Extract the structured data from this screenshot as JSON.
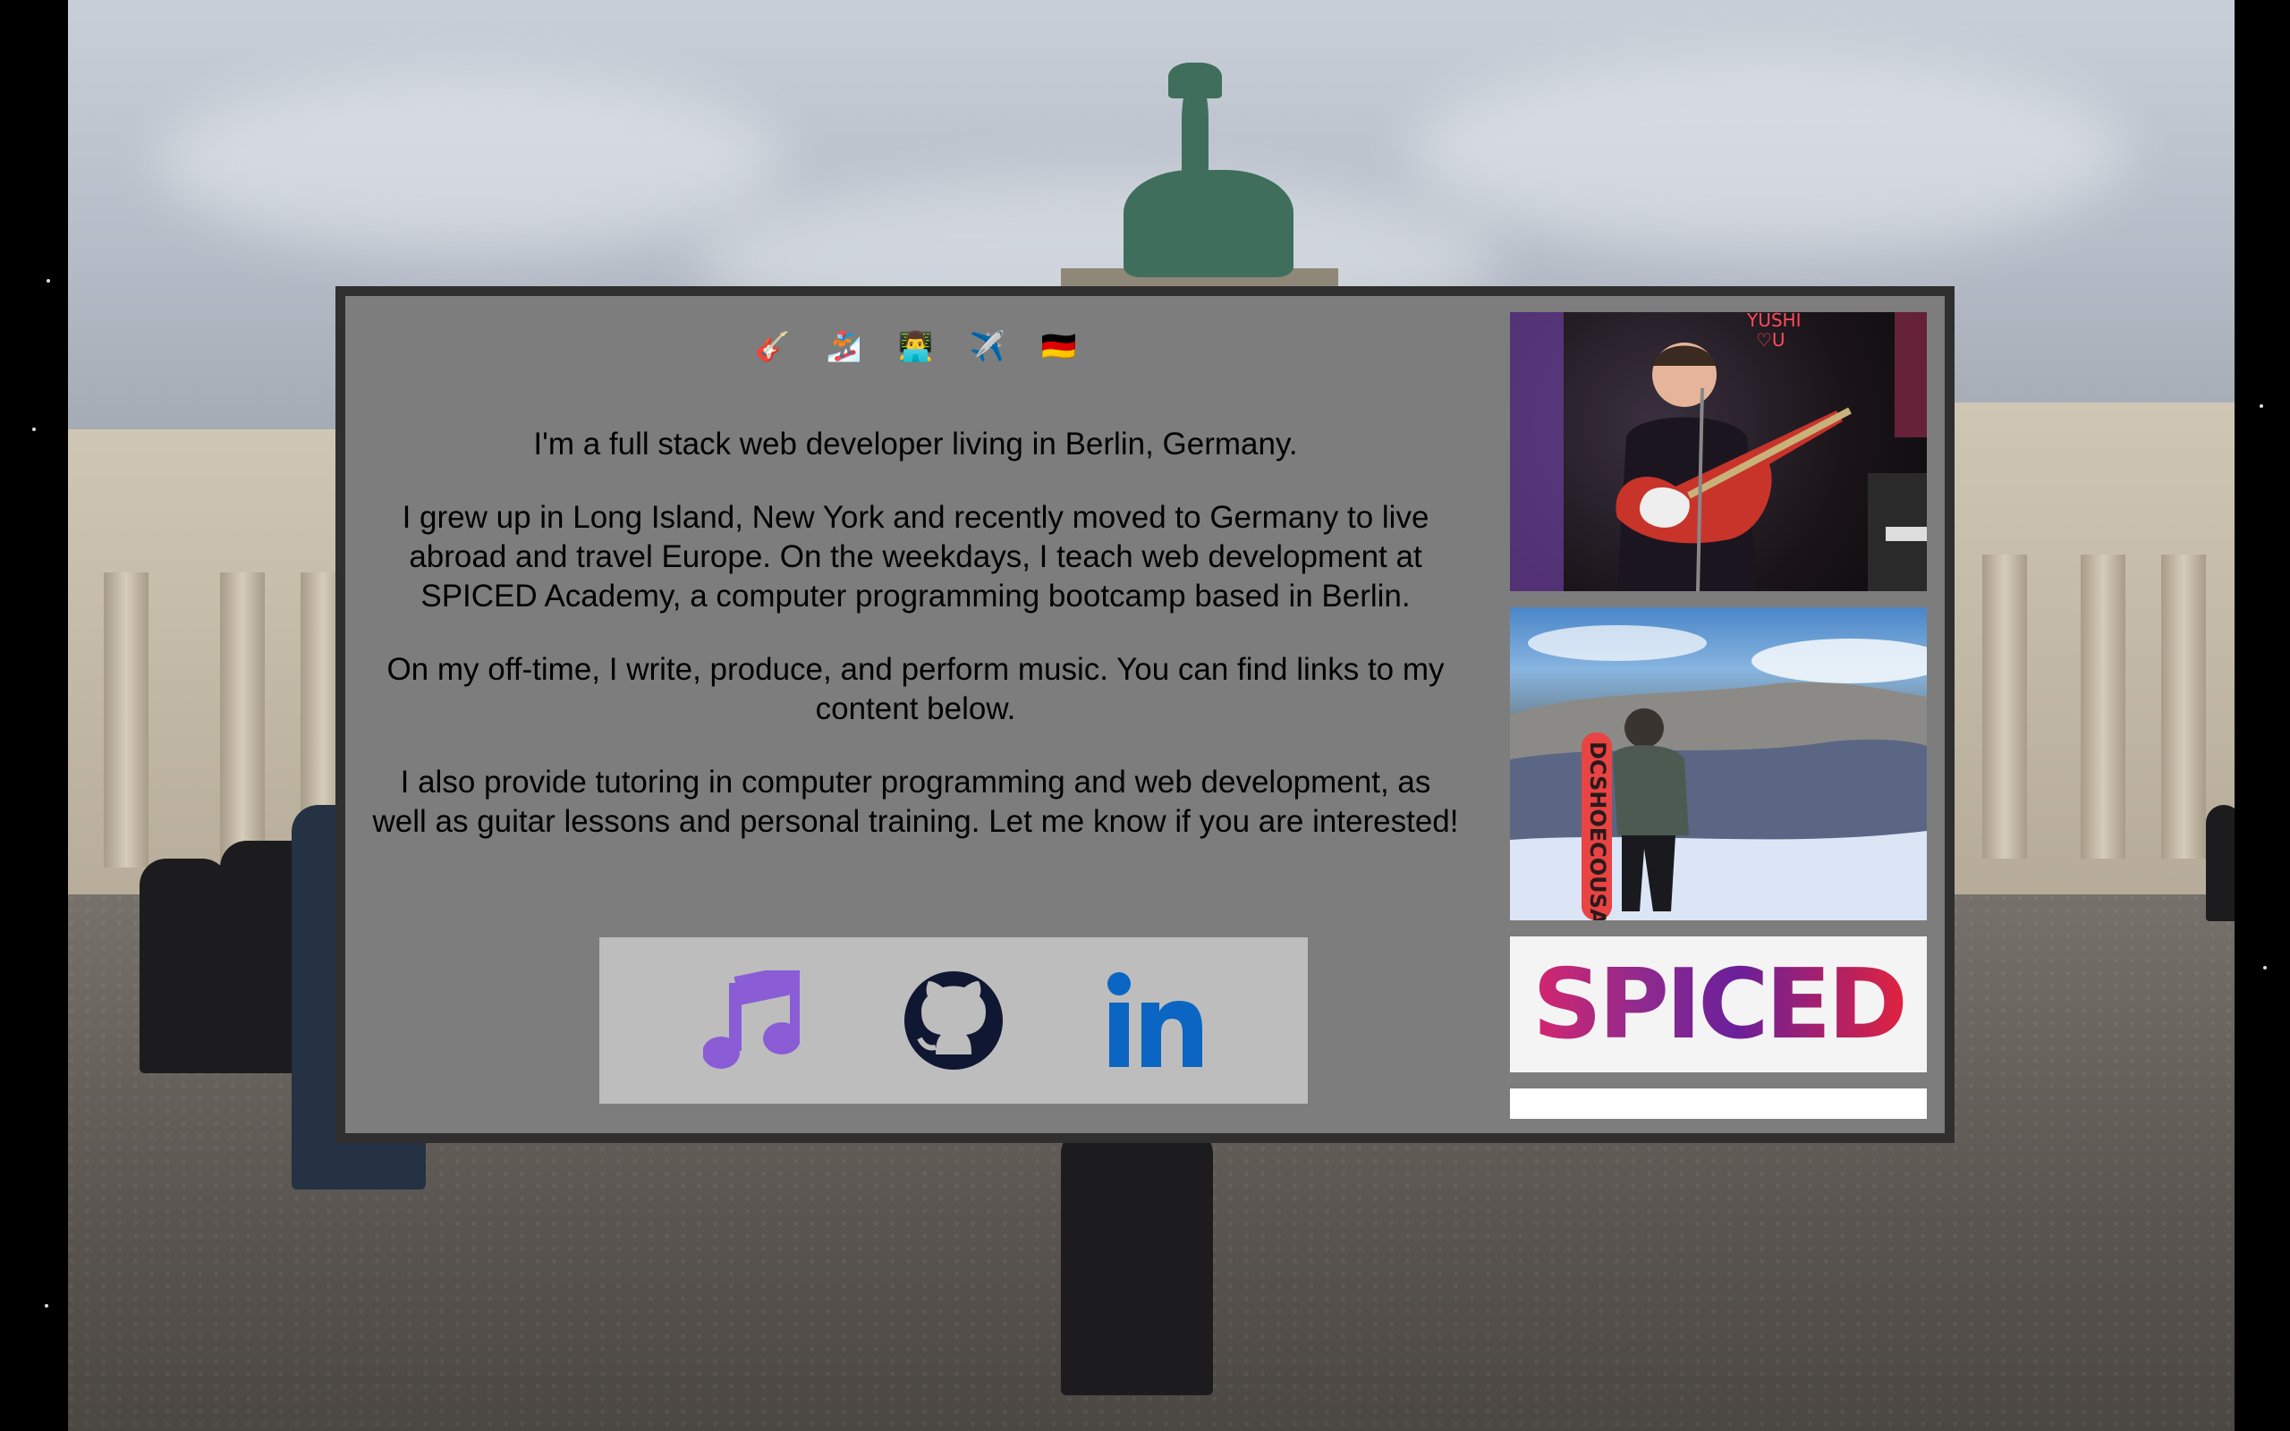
{
  "header_emojis": [
    {
      "char": "🎸",
      "icon": "guitar-icon"
    },
    {
      "char": "🏂",
      "icon": "snowboarder-icon"
    },
    {
      "char": "👨‍💻",
      "icon": "technologist-icon"
    },
    {
      "char": "✈️",
      "icon": "airplane-icon"
    },
    {
      "char": "🇩🇪",
      "icon": "germany-flag-icon"
    }
  ],
  "bio": {
    "p1": "I'm a full stack web developer living in Berlin, Germany.",
    "p2": "I grew up in Long Island, New York and recently moved to Germany to live abroad and travel Europe. On the weekdays, I teach web development at SPICED Academy, a computer programming bootcamp based in Berlin.",
    "p3": "On my off-time, I write, produce, and perform music. You can find links to my content below.",
    "p4": "I also provide tutoring in computer programming and web development, as well as guitar lessons and personal training. Let me know if you are interested!"
  },
  "links": [
    {
      "icon": "music-note-icon",
      "color": "#8a5cd6"
    },
    {
      "icon": "github-icon",
      "color": "#0f1733"
    },
    {
      "icon": "linkedin-icon",
      "color": "#0a66c2"
    }
  ],
  "gallery": {
    "spiced_logo_text": "SPICED",
    "snow_board_text": "DCSHOECOUSA"
  },
  "colors": {
    "panel_bg": "#7d7d7d",
    "panel_border": "#2f2f2f",
    "links_bg": "#bdbdbd"
  }
}
